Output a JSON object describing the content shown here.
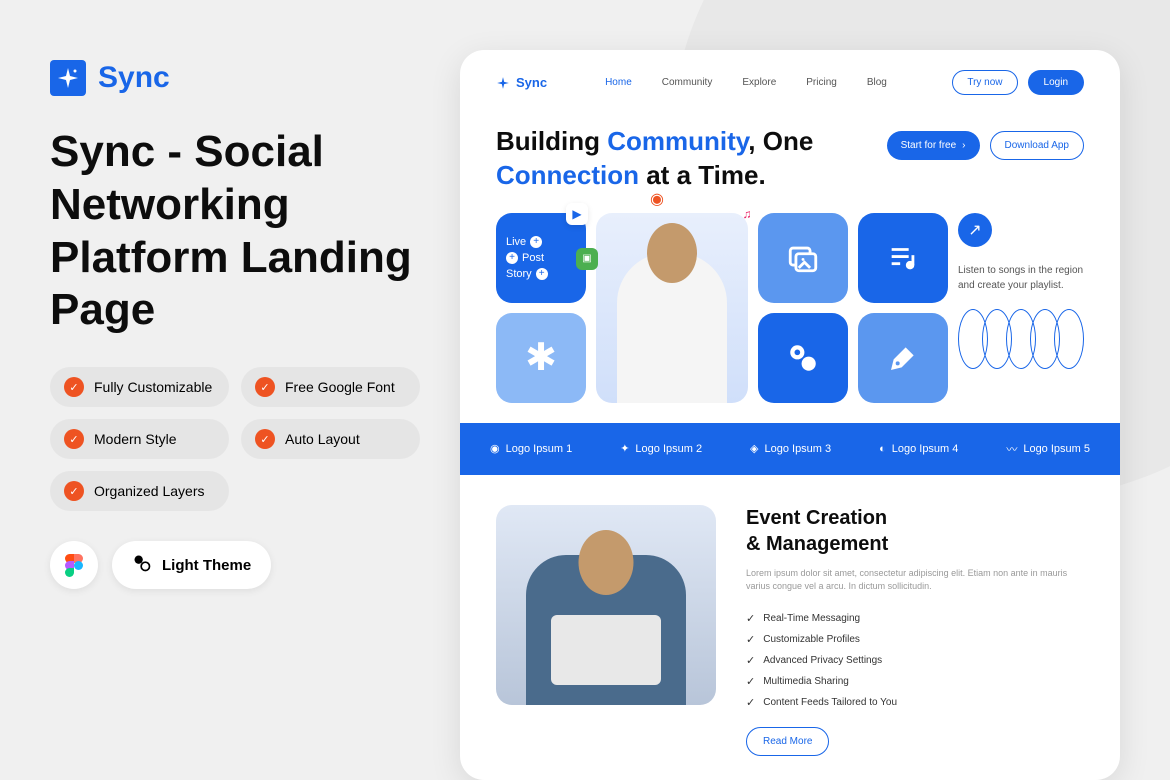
{
  "logo": {
    "name": "Sync"
  },
  "main_title": "Sync - Social Networking Platform Landing Page",
  "features": [
    "Fully Customizable",
    "Free Google Font",
    "Modern Style",
    "Auto Layout",
    "Organized Layers"
  ],
  "theme_label": "Light Theme",
  "nav": {
    "brand": "Sync",
    "links": [
      "Home",
      "Community",
      "Explore",
      "Pricing",
      "Blog"
    ],
    "try_now": "Try now",
    "login": "Login"
  },
  "hero": {
    "line1_a": "Building ",
    "line1_b": "Community",
    "line1_c": ", One",
    "line2_a": "Connection",
    "line2_b": " at a Time.",
    "start_free": "Start for free",
    "download": "Download App",
    "live": "Live",
    "post": "Post",
    "story": "Story",
    "listen": "Listen to songs in the region and create your playlist."
  },
  "logos": [
    "Logo Ipsum 1",
    "Logo Ipsum 2",
    "Logo Ipsum 3",
    "Logo Ipsum 4",
    "Logo Ipsum 5"
  ],
  "event": {
    "title_l1": "Event Creation",
    "title_l2": "& Management",
    "desc": "Lorem ipsum dolor sit amet, consectetur adipiscing elit. Etiam non ante in mauris varius congue vel a arcu. In dictum sollicitudin.",
    "items": [
      "Real-Time Messaging",
      "Customizable Profiles",
      "Advanced Privacy Settings",
      "Multimedia Sharing",
      "Content Feeds Tailored to You"
    ],
    "read_more": "Read More"
  }
}
